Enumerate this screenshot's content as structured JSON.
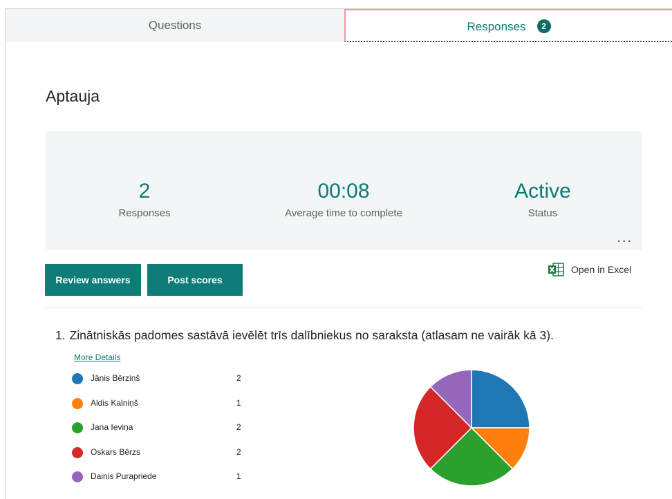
{
  "tabs": {
    "questions_label": "Questions",
    "responses_label": "Responses",
    "responses_badge": "2"
  },
  "form": {
    "title": "Aptauja"
  },
  "summary": {
    "responses_value": "2",
    "responses_label": "Responses",
    "avg_time_value": "00:08",
    "avg_time_label": "Average time to complete",
    "status_value": "Active",
    "status_label": "Status",
    "more_label": "..."
  },
  "actions": {
    "review_label": "Review answers",
    "post_label": "Post scores",
    "excel_label": "Open in Excel"
  },
  "question1": {
    "number": "1.",
    "text": "Zinātniskās padomes sastāvā ievēlēt trīs dalībniekus no saraksta (atlasam ne vairāk kā 3).",
    "more_details": "More Details",
    "options": [
      {
        "label": "Jānis Bērziņš",
        "count": "2",
        "color": "#1f77b4"
      },
      {
        "label": "Aldis Kalniņš",
        "count": "1",
        "color": "#ff7f0e"
      },
      {
        "label": "Jana Ieviņa",
        "count": "2",
        "color": "#2ca02c"
      },
      {
        "label": "Oskars Bērzs",
        "count": "2",
        "color": "#d62728"
      },
      {
        "label": "Dainis Purapriede",
        "count": "1",
        "color": "#9467bd"
      }
    ]
  },
  "colors": {
    "accent": "#0b7a75",
    "button": "#0f7c78",
    "tab_active_border": "#f29b9c"
  },
  "icons": {
    "excel": "excel-icon",
    "more": "more-options-icon"
  }
}
